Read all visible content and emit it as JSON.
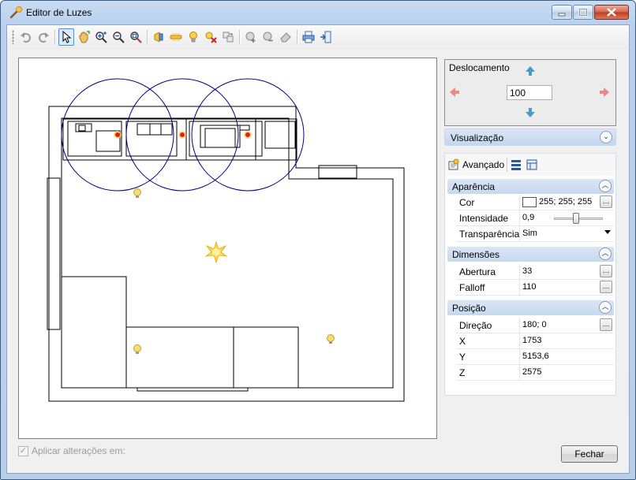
{
  "window": {
    "title": "Editor de Luzes"
  },
  "toolbar": {
    "buttons": [
      {
        "icon": "undo-icon"
      },
      {
        "icon": "redo-icon"
      },
      {
        "icon": "select-pointer-icon",
        "active": true
      },
      {
        "icon": "pan-hand-icon"
      },
      {
        "icon": "zoom-in-icon"
      },
      {
        "icon": "zoom-out-icon"
      },
      {
        "icon": "zoom-extents-icon"
      },
      {
        "icon": "spot-light-icon"
      },
      {
        "icon": "linear-light-icon"
      },
      {
        "icon": "bulb-icon"
      },
      {
        "icon": "delete-light-icon"
      },
      {
        "icon": "copy-light-icon"
      },
      {
        "icon": "group-add-icon"
      },
      {
        "icon": "group-remove-icon"
      },
      {
        "icon": "eraser-icon"
      },
      {
        "icon": "print-icon"
      },
      {
        "icon": "export-icon"
      }
    ]
  },
  "apply": {
    "label": "Aplicar alterações em:",
    "checked": true,
    "enabled": false
  },
  "close_button": {
    "label": "Fechar"
  },
  "pan": {
    "title": "Deslocamento",
    "value": "100"
  },
  "visualization": {
    "label": "Visualização"
  },
  "property_grid": {
    "toolbar_label": "Avançado",
    "categories": {
      "appearance": {
        "label": "Aparência",
        "rows": {
          "color": {
            "name": "Cor",
            "value": "255; 255; 255"
          },
          "intensity": {
            "name": "Intensidade",
            "value": "0,9"
          },
          "transparency": {
            "name": "Transparência",
            "value": "Sim"
          }
        }
      },
      "dimensions": {
        "label": "Dimensões",
        "rows": {
          "aperture": {
            "name": "Abertura",
            "value": "33"
          },
          "falloff": {
            "name": "Falloff",
            "value": "110"
          }
        }
      },
      "position": {
        "label": "Posição",
        "rows": {
          "direction": {
            "name": "Direção",
            "value": "180; 0"
          },
          "x": {
            "name": "X",
            "value": "1753"
          },
          "y": {
            "name": "Y",
            "value": "5153,6"
          },
          "z": {
            "name": "Z",
            "value": "2575"
          }
        }
      }
    }
  },
  "colors": {
    "accent": "#3399ff",
    "header": "#c5d7ef",
    "circle": "#000080"
  }
}
